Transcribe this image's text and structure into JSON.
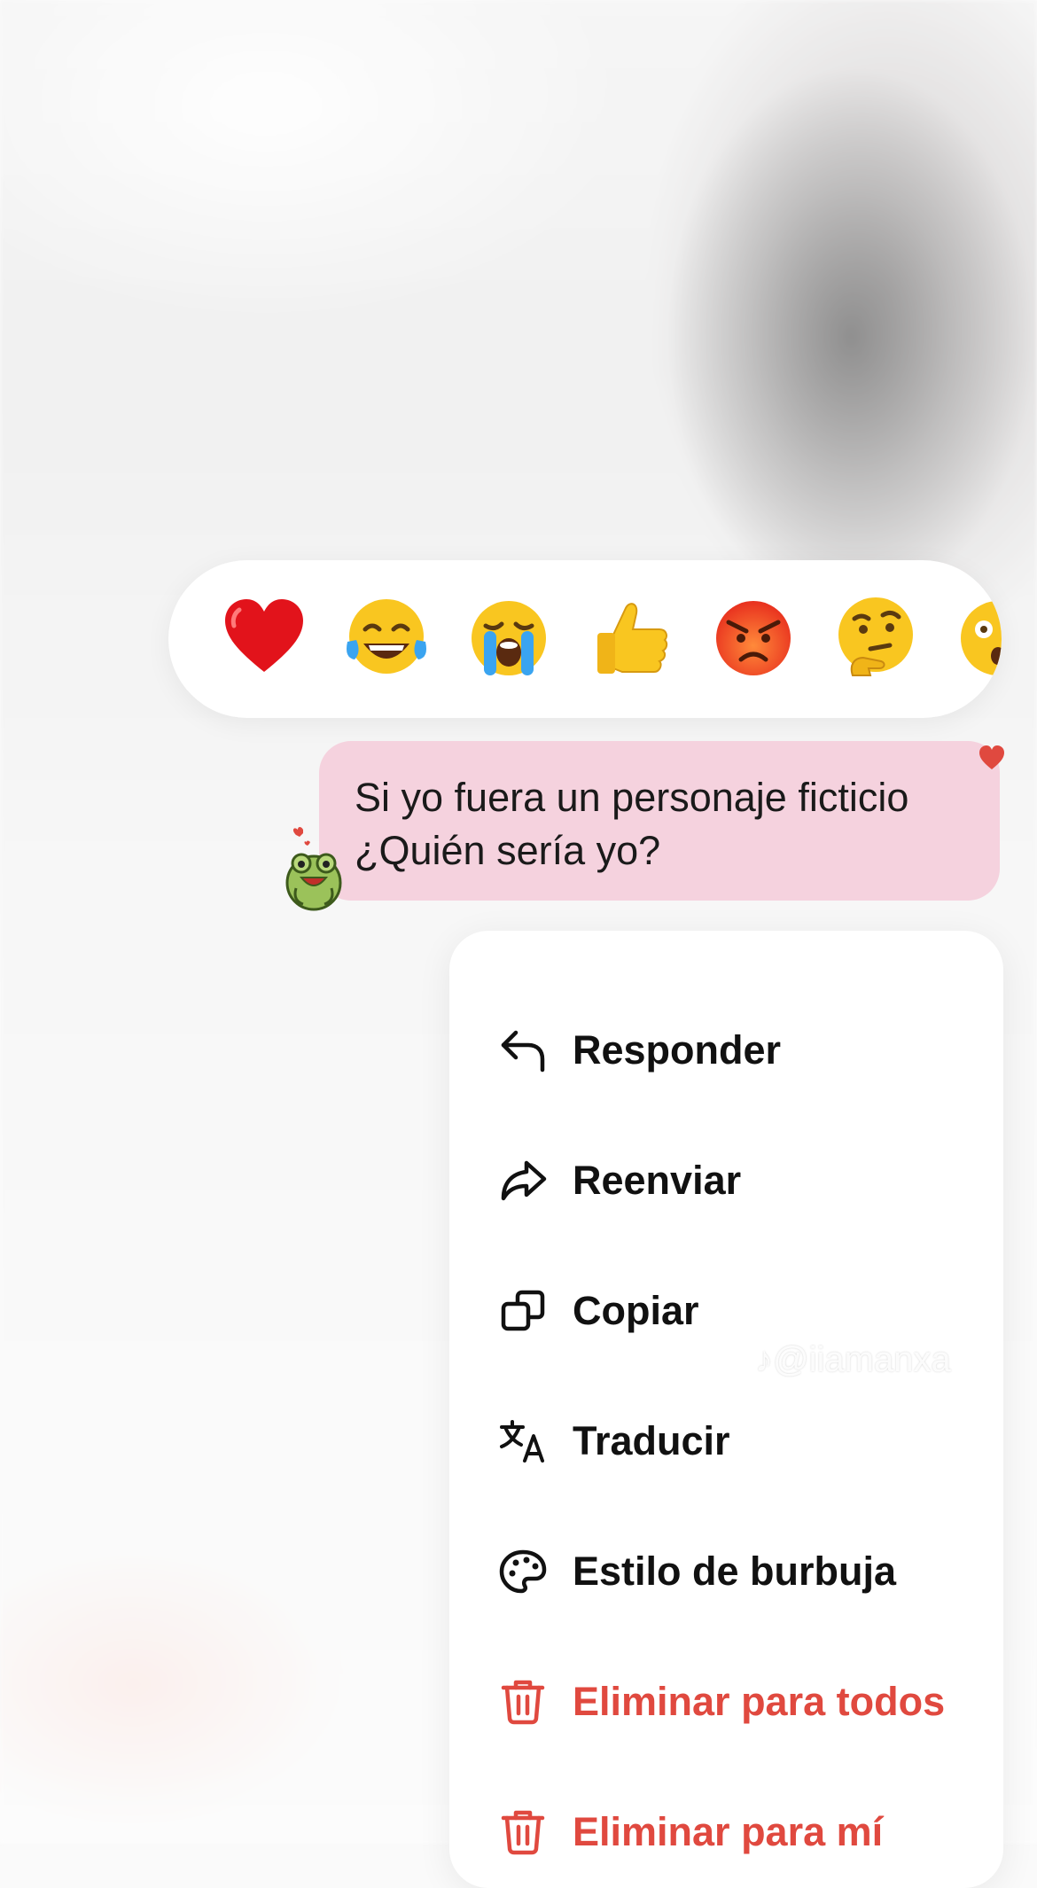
{
  "reactions": [
    {
      "name": "red-heart-emoji"
    },
    {
      "name": "tears-of-joy-emoji"
    },
    {
      "name": "loudly-crying-emoji"
    },
    {
      "name": "thumbs-up-emoji"
    },
    {
      "name": "angry-face-emoji"
    },
    {
      "name": "thinking-face-emoji"
    },
    {
      "name": "astonished-face-emoji"
    }
  ],
  "message": {
    "line1": "Si yo fuera un personaje ficticio",
    "line2": "¿Quién sería yo?",
    "bubble_color": "#f5d2de"
  },
  "menu": {
    "items": [
      {
        "label": "Responder",
        "icon": "reply-icon"
      },
      {
        "label": "Reenviar",
        "icon": "forward-icon"
      },
      {
        "label": "Copiar",
        "icon": "copy-icon"
      },
      {
        "label": "Traducir",
        "icon": "translate-icon"
      },
      {
        "label": "Estilo de burbuja",
        "icon": "palette-icon"
      },
      {
        "label": "Eliminar para todos",
        "icon": "trash-icon"
      },
      {
        "label": "Eliminar para mí",
        "icon": "trash-icon"
      }
    ],
    "danger_color": "#e0493f"
  },
  "watermark": "♪@iiamanxa"
}
